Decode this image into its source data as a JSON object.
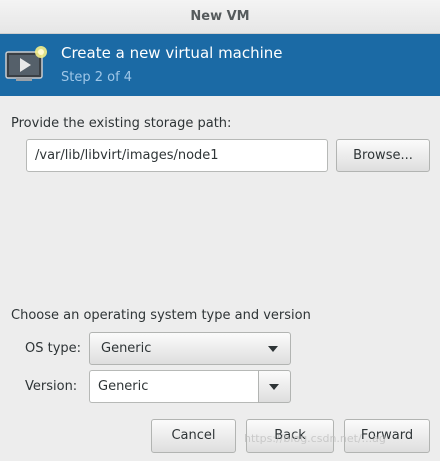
{
  "window": {
    "title": "New VM"
  },
  "header": {
    "title": "Create a new virtual machine",
    "step": "Step 2 of 4",
    "icon": "vm-play-icon"
  },
  "storage": {
    "label": "Provide the existing storage path:",
    "path_value": "/var/lib/libvirt/images/node1",
    "browse_label": "Browse..."
  },
  "os": {
    "section_label": "Choose an operating system type and version",
    "type_label": "OS type:",
    "type_value": "Generic",
    "version_label": "Version:",
    "version_value": "Generic"
  },
  "buttons": {
    "cancel": "Cancel",
    "back": "Back",
    "forward": "Forward"
  },
  "watermark": "https://blog.csdn.net/...ag",
  "colors": {
    "header_bg": "#1b6aa5",
    "step_text": "#9fc7e8"
  }
}
